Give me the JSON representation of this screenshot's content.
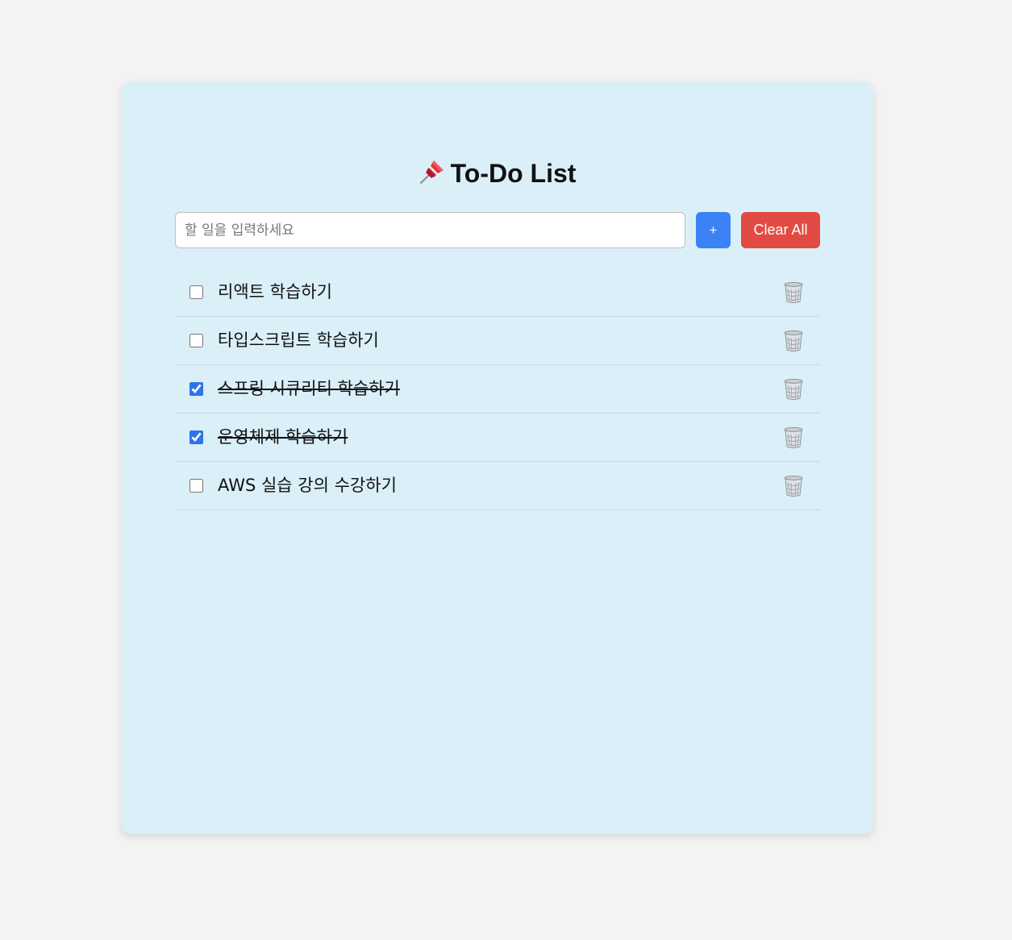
{
  "header": {
    "title": "To-Do List",
    "title_icon": "pushpin-icon"
  },
  "input": {
    "placeholder": "할 일을 입력하세요",
    "value": ""
  },
  "buttons": {
    "add_label": "+",
    "clear_label": "Clear All"
  },
  "todos": [
    {
      "text": "리액트 학습하기",
      "completed": false
    },
    {
      "text": "타입스크립트 학습하기",
      "completed": false
    },
    {
      "text": "스프링 시큐리티 학습하기",
      "completed": true
    },
    {
      "text": "운영체제 학습하기",
      "completed": true
    },
    {
      "text": "AWS 실습 강의 수강하기",
      "completed": false
    }
  ],
  "icons": {
    "delete": "trash-icon"
  },
  "colors": {
    "page_background": "#f3f3f3",
    "card_background": "#daeff8",
    "add_button": "#3b82f6",
    "clear_button": "#e14b43",
    "checkbox_accent": "#2f74e8"
  }
}
